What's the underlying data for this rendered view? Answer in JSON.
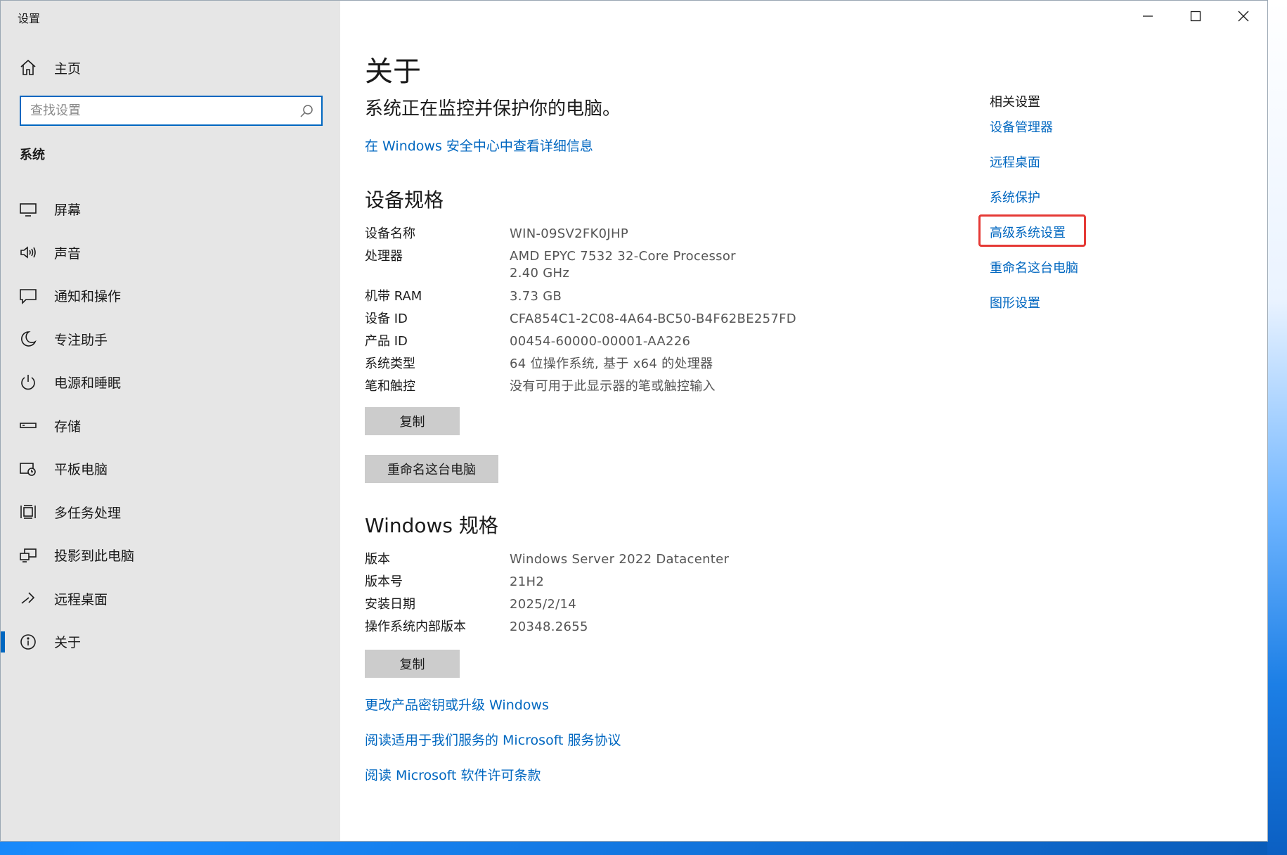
{
  "window": {
    "title": "设置"
  },
  "sidebar": {
    "home_label": "主页",
    "search_placeholder": "查找设置",
    "section_label": "系统",
    "items": [
      {
        "label": "屏幕",
        "icon": "monitor-icon"
      },
      {
        "label": "声音",
        "icon": "speaker-icon"
      },
      {
        "label": "通知和操作",
        "icon": "notification-icon"
      },
      {
        "label": "专注助手",
        "icon": "moon-icon"
      },
      {
        "label": "电源和睡眠",
        "icon": "power-icon"
      },
      {
        "label": "存储",
        "icon": "storage-icon"
      },
      {
        "label": "平板电脑",
        "icon": "tablet-icon"
      },
      {
        "label": "多任务处理",
        "icon": "multitask-icon"
      },
      {
        "label": "投影到此电脑",
        "icon": "project-icon"
      },
      {
        "label": "远程桌面",
        "icon": "remote-icon"
      },
      {
        "label": "关于",
        "icon": "info-icon",
        "active": true
      }
    ]
  },
  "main": {
    "title": "关于",
    "status": "系统正在监控并保护你的电脑。",
    "security_link": "在 Windows 安全中心中查看详细信息",
    "device_spec": {
      "heading": "设备规格",
      "rows": [
        {
          "key": "设备名称",
          "value": "WIN-09SV2FK0JHP"
        },
        {
          "key": "处理器",
          "value": "AMD EPYC 7532 32-Core Processor",
          "value2": "2.40 GHz"
        },
        {
          "key": "机带 RAM",
          "value": "3.73 GB"
        },
        {
          "key": "设备 ID",
          "value": "CFA854C1-2C08-4A64-BC50-B4F62BE257FD"
        },
        {
          "key": "产品 ID",
          "value": "00454-60000-00001-AA226"
        },
        {
          "key": "系统类型",
          "value": "64 位操作系统, 基于 x64 的处理器"
        },
        {
          "key": "笔和触控",
          "value": "没有可用于此显示器的笔或触控输入"
        }
      ],
      "copy_label": "复制",
      "rename_label": "重命名这台电脑"
    },
    "windows_spec": {
      "heading": "Windows 规格",
      "rows": [
        {
          "key": "版本",
          "value": "Windows Server 2022 Datacenter"
        },
        {
          "key": "版本号",
          "value": "21H2"
        },
        {
          "key": "安装日期",
          "value": "2025/2/14"
        },
        {
          "key": "操作系统内部版本",
          "value": "20348.2655"
        }
      ],
      "copy_label": "复制"
    },
    "links": [
      "更改产品密钥或升级 Windows",
      "阅读适用于我们服务的 Microsoft 服务协议",
      "阅读 Microsoft 软件许可条款"
    ]
  },
  "related": {
    "title": "相关设置",
    "links": [
      "设备管理器",
      "远程桌面",
      "系统保护",
      "高级系统设置",
      "重命名这台电脑",
      "图形设置"
    ],
    "highlighted": "高级系统设置"
  },
  "colors": {
    "accent": "#0067c0",
    "highlight": "#e53935",
    "sidebar_bg": "#e6e6e6",
    "button_bg": "#cccccc"
  }
}
